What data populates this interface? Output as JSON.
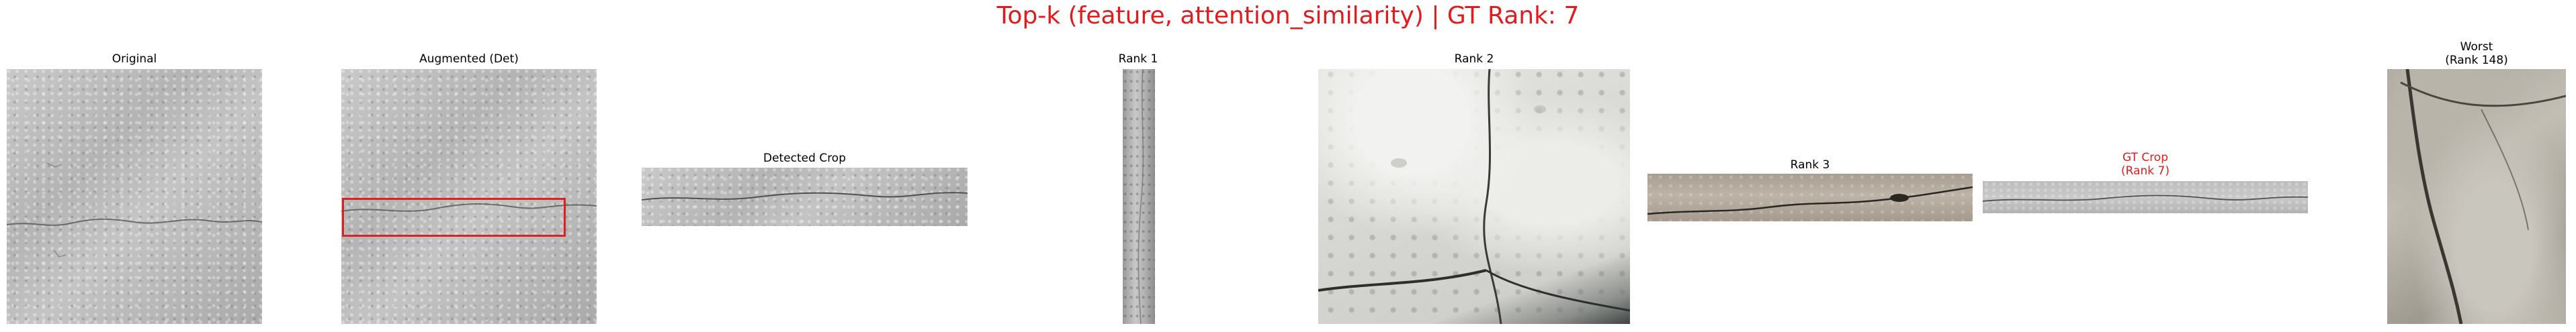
{
  "figure": {
    "suptitle": "Top-k (feature, attention_similarity) | GT Rank: 7",
    "suptitle_color": "#e41a1c",
    "panels": [
      {
        "key": "original",
        "title": "Original",
        "title_color": "#000000"
      },
      {
        "key": "augmented",
        "title": "Augmented (Det)",
        "title_color": "#000000",
        "box_color": "#e02020"
      },
      {
        "key": "detected_crop",
        "title": "Detected Crop",
        "title_color": "#000000"
      },
      {
        "key": "rank1",
        "title": "Rank 1",
        "title_color": "#000000"
      },
      {
        "key": "rank2",
        "title": "Rank 2",
        "title_color": "#000000"
      },
      {
        "key": "rank3",
        "title": "Rank 3",
        "title_color": "#000000"
      },
      {
        "key": "gt_crop",
        "title": "GT Crop\n(Rank 7)",
        "title_color": "#e41a1c"
      },
      {
        "key": "worst",
        "title": "Worst\n(Rank 148)",
        "title_color": "#000000"
      }
    ]
  }
}
